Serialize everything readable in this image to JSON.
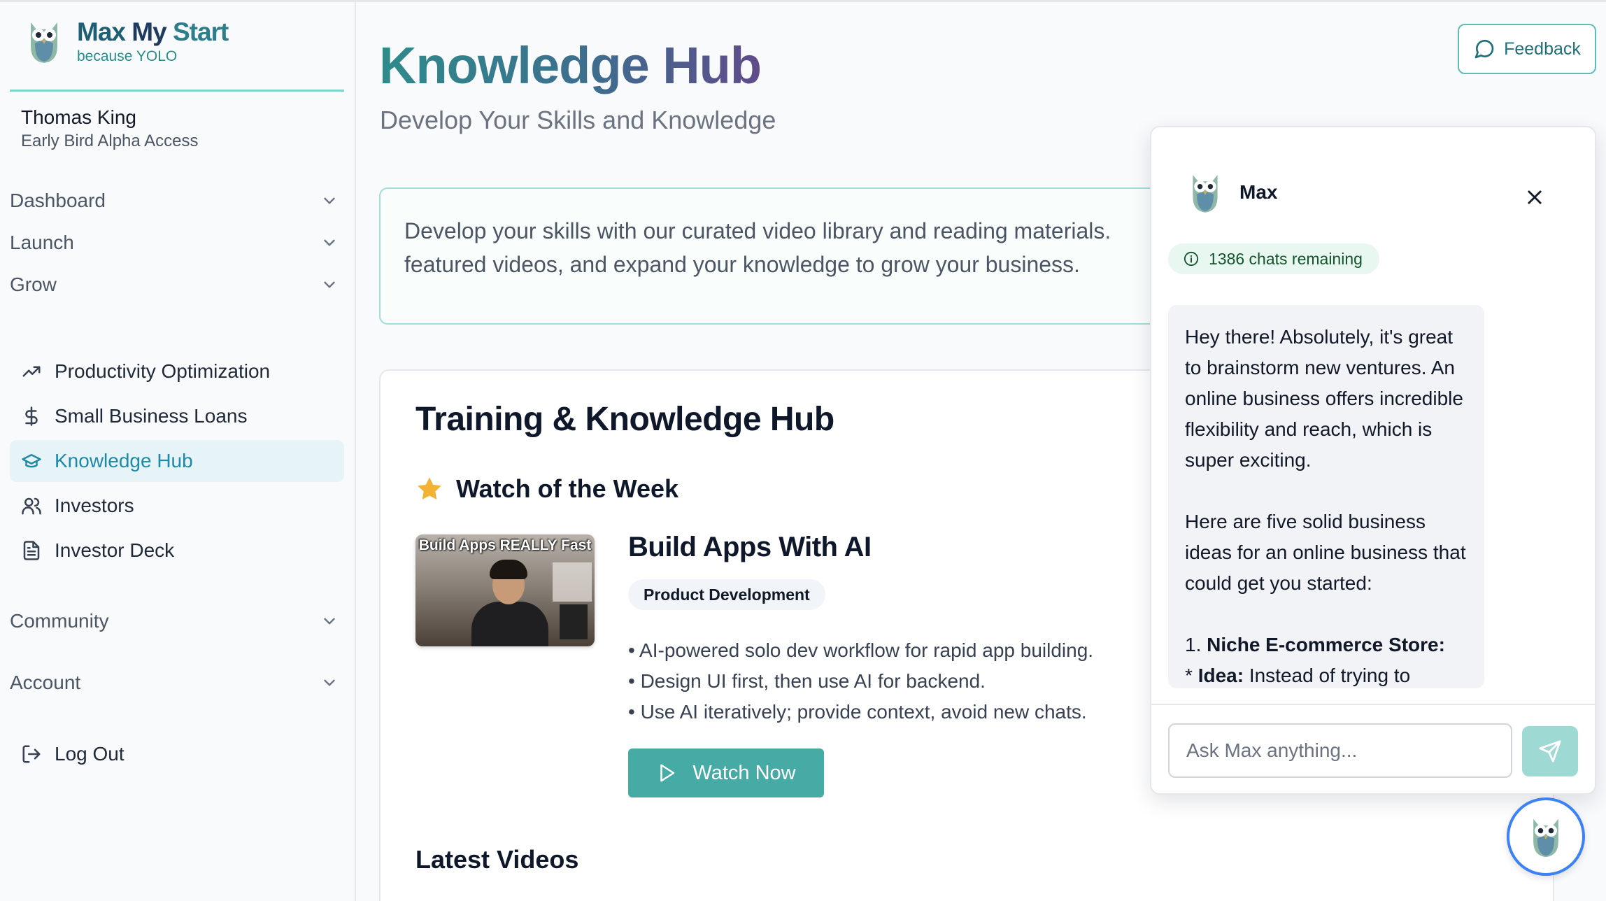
{
  "brand": {
    "name_part1": "Max",
    "name_part2": "My",
    "name_part3": "Start",
    "tagline": "because YOLO"
  },
  "user": {
    "name": "Thomas King",
    "role": "Early Bird Alpha Access"
  },
  "sidebar": {
    "sections": [
      {
        "label": "Dashboard"
      },
      {
        "label": "Launch"
      },
      {
        "label": "Grow"
      },
      {
        "label": "Community"
      },
      {
        "label": "Account"
      }
    ],
    "grow_items": [
      {
        "label": "Productivity Optimization",
        "icon": "trending-up-icon"
      },
      {
        "label": "Small Business Loans",
        "icon": "dollar-icon"
      },
      {
        "label": "Knowledge Hub",
        "icon": "graduation-cap-icon",
        "active": true
      },
      {
        "label": "Investors",
        "icon": "users-icon"
      },
      {
        "label": "Investor Deck",
        "icon": "file-text-icon"
      }
    ],
    "logout_label": "Log Out"
  },
  "header": {
    "title": "Knowledge Hub",
    "subtitle": "Develop Your Skills and Knowledge",
    "feedback_label": "Feedback"
  },
  "intro": {
    "line1": "Develop your skills with our curated video library and reading materials.",
    "line2": "featured videos, and expand your knowledge to grow your business."
  },
  "hub": {
    "title": "Training & Knowledge Hub",
    "watch_heading": "Watch of the Week",
    "video": {
      "thumbnail_caption": "Build Apps REALLY Fast",
      "title": "Build Apps With AI",
      "tag": "Product Development",
      "bullets": [
        "• AI-powered solo dev workflow for rapid app building.",
        "• Design UI first, then use AI for backend.",
        "• Use AI iteratively; provide context, avoid new chats."
      ],
      "watch_label": "Watch Now"
    },
    "latest_heading": "Latest Videos"
  },
  "chat": {
    "name": "Max",
    "remaining": "1386 chats remaining",
    "message": {
      "para1": "Hey there! Absolutely, it's great to brainstorm new ventures. An online business offers incredible flexibility and reach, which is super exciting.",
      "para2": "Here are five solid business ideas for an online business that could get you started:",
      "item1_prefix": "1. ",
      "item1_bold": "Niche E-commerce Store:",
      "item1_sub_prefix": "* ",
      "item1_sub_bold": "Idea:",
      "item1_sub_text": " Instead of trying to"
    },
    "input_placeholder": "Ask Max anything..."
  },
  "colors": {
    "accent": "#46aaa5",
    "active_nav_bg": "#e6f4f8",
    "active_nav_text": "#1e8aa8",
    "fab_border": "#3b82f6"
  }
}
